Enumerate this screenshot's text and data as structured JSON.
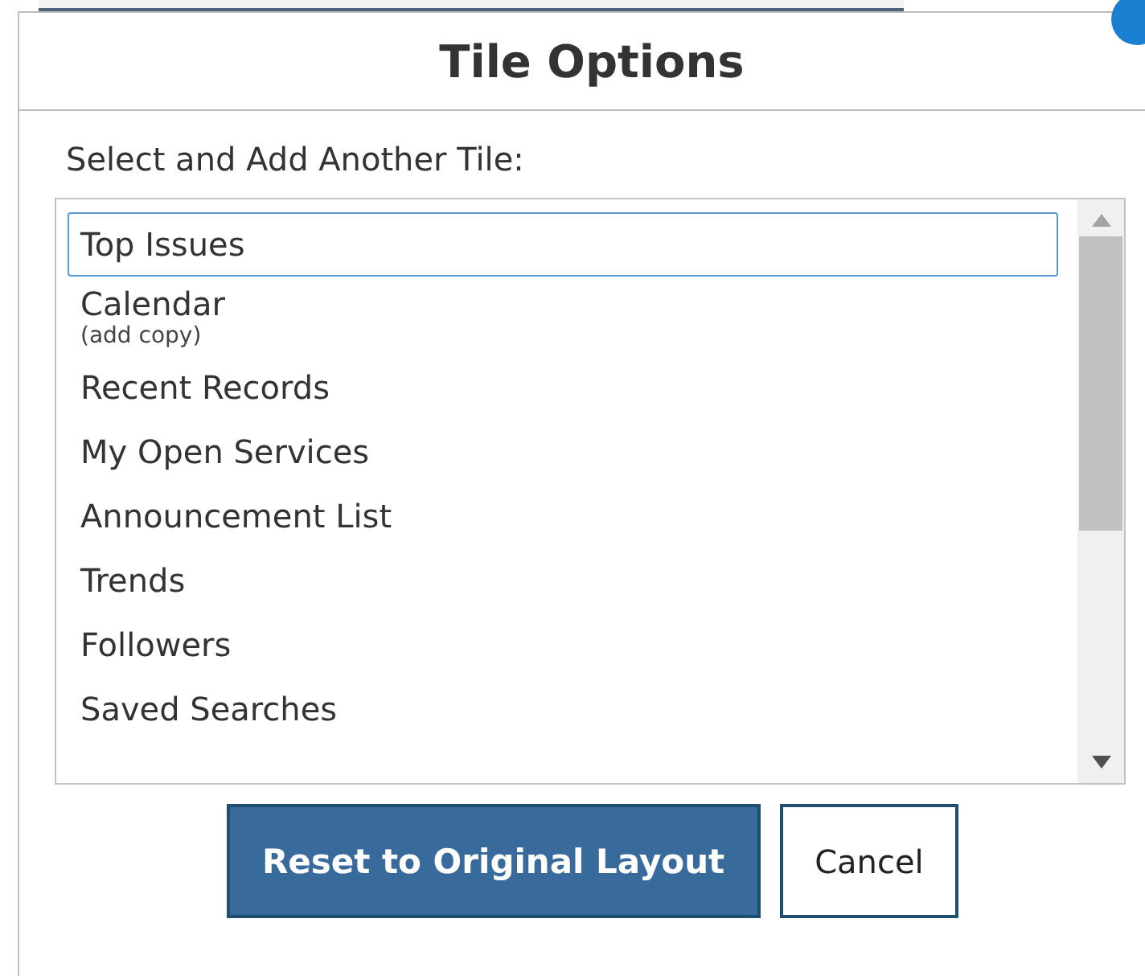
{
  "dialog": {
    "title": "Tile Options",
    "prompt": "Select and Add Another Tile:",
    "tiles": [
      {
        "label": "Top Issues",
        "selected": true
      },
      {
        "label": "Calendar",
        "note": "(add copy)",
        "selected": false
      },
      {
        "label": "Recent Records",
        "selected": false
      },
      {
        "label": "My Open Services",
        "selected": false
      },
      {
        "label": "Announcement List",
        "selected": false
      },
      {
        "label": "Trends",
        "selected": false
      },
      {
        "label": "Followers",
        "selected": false
      },
      {
        "label": "Saved Searches",
        "selected": false
      }
    ],
    "buttons": [
      {
        "label": "Reset to Original Layout",
        "kind": "primary"
      },
      {
        "label": "Cancel",
        "kind": "secondary"
      }
    ]
  }
}
